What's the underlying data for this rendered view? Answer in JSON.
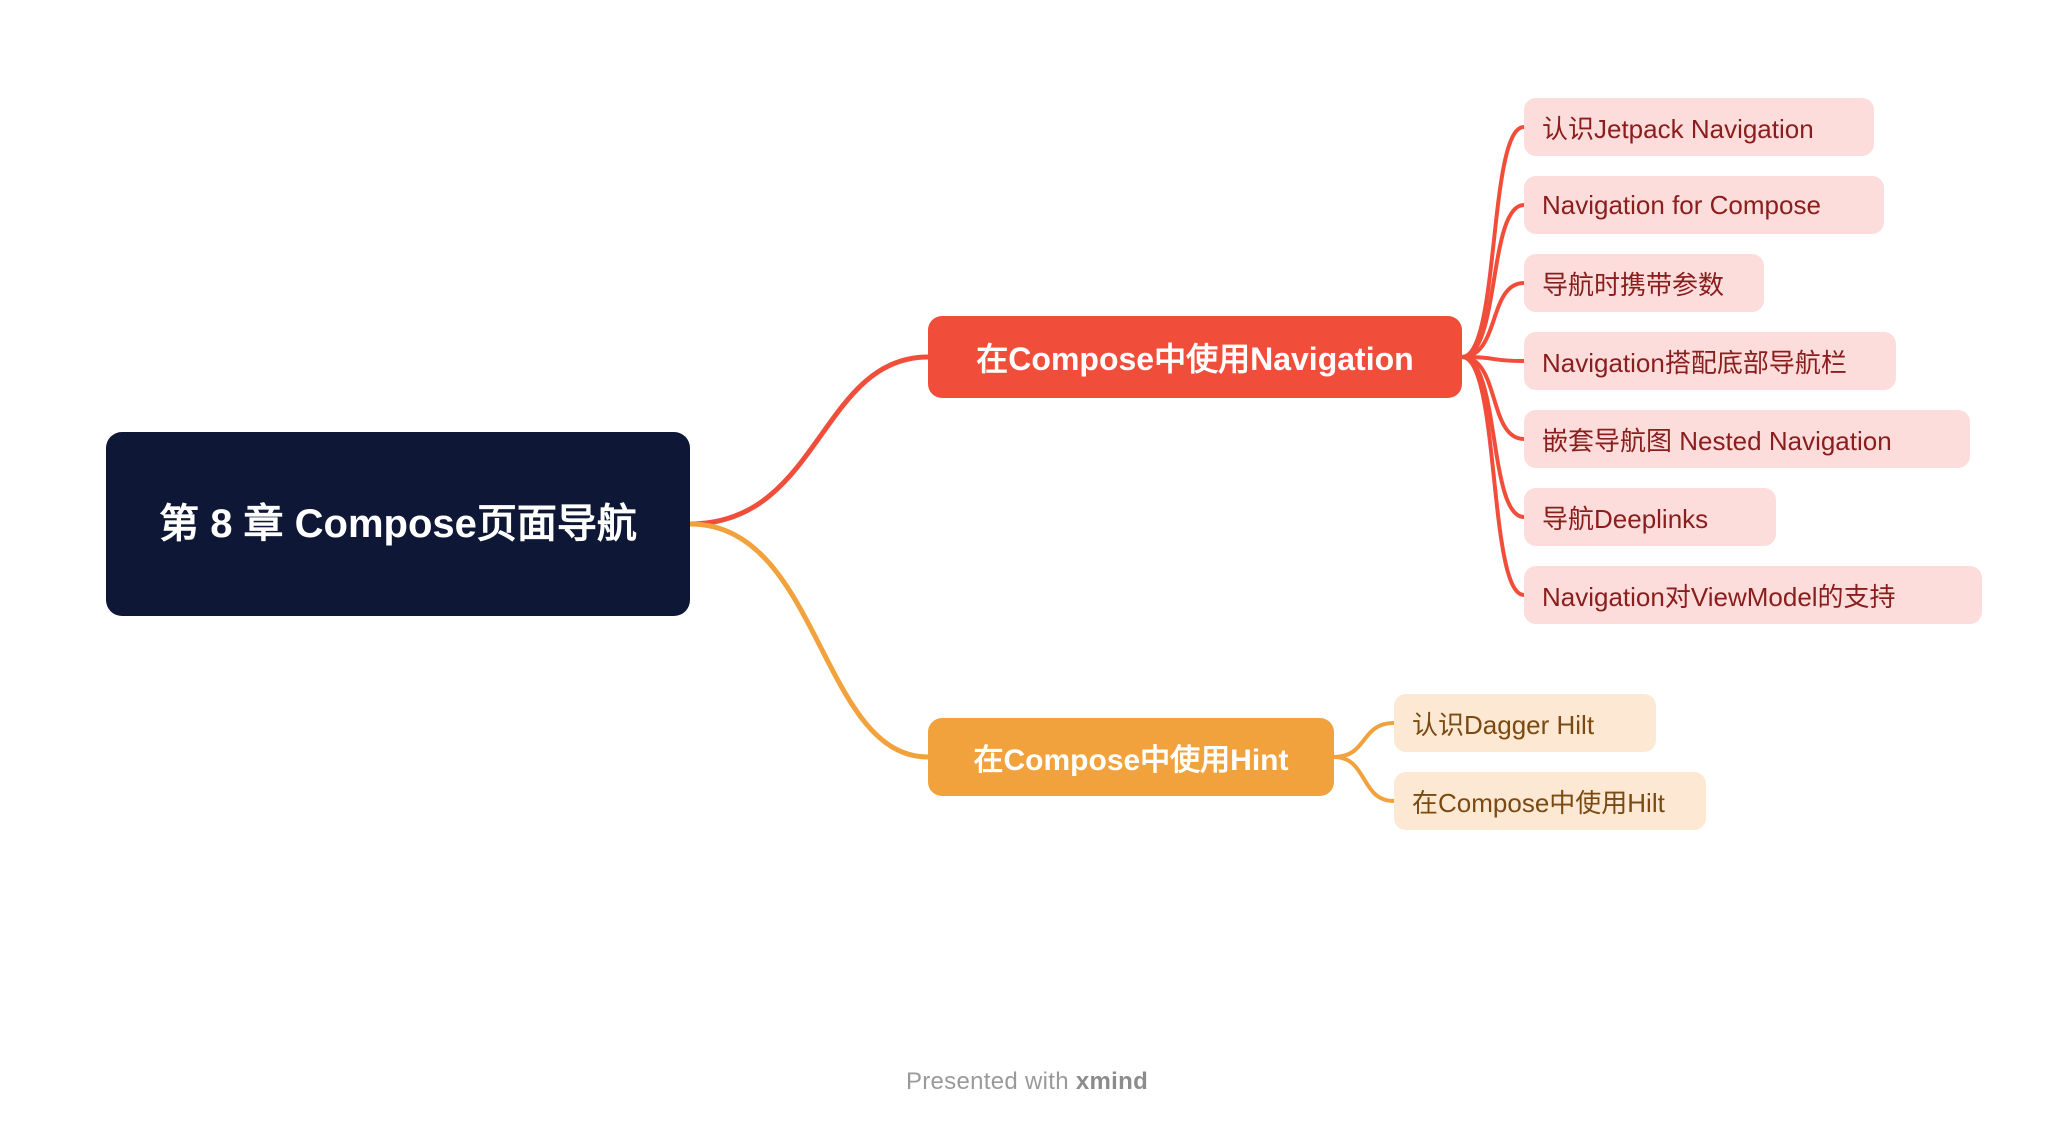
{
  "root": {
    "title": "第 8 章 Compose页面导航"
  },
  "branches": [
    {
      "label": "在Compose中使用Navigation",
      "color": "red",
      "leaves": [
        "认识Jetpack Navigation",
        "Navigation for Compose",
        "导航时携带参数",
        "Navigation搭配底部导航栏",
        "嵌套导航图 Nested Navigation",
        "导航Deeplinks",
        "Navigation对ViewModel的支持"
      ]
    },
    {
      "label": "在Compose中使用Hint",
      "color": "orange",
      "leaves": [
        "认识Dagger Hilt",
        "在Compose中使用Hilt"
      ]
    }
  ],
  "footer": {
    "prefix": "Presented with ",
    "brand": "xmind"
  },
  "colors": {
    "root_bg": "#0e1735",
    "branch1_bg": "#f04e3a",
    "branch2_bg": "#f2a23d",
    "leaf_red_bg": "#fcdddc",
    "leaf_red_fg": "#8a1e1d",
    "leaf_orange_bg": "#fde9d3",
    "leaf_orange_fg": "#7a4a12",
    "connector_red": "#f04e3a",
    "connector_orange": "#f2a23d"
  }
}
